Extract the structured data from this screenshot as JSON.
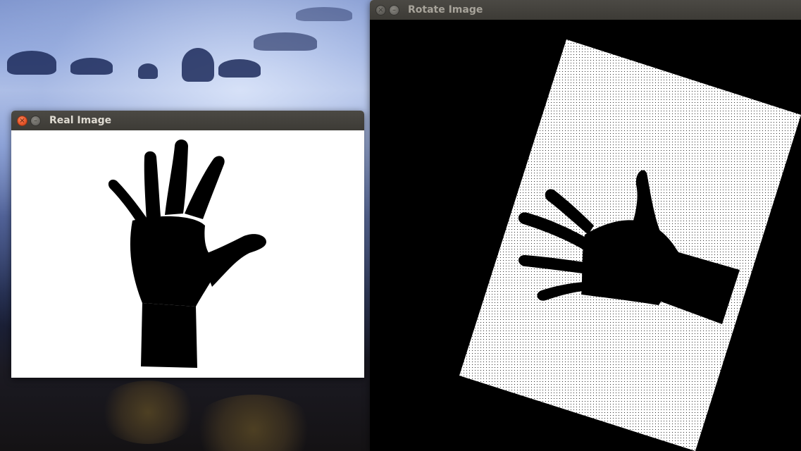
{
  "desktop": {
    "wallpaper": "misty-blue-landscape"
  },
  "windows": {
    "real": {
      "title": "Real Image",
      "active": true,
      "canvas_background": "#ffffff",
      "shape_color": "#000000",
      "content": "hand-silhouette"
    },
    "rotate": {
      "title": "Rotate Image",
      "active": false,
      "canvas_background": "#000000",
      "rotated_panel_color": "#ffffff",
      "shape_color": "#000000",
      "content": "rotated-hand-silhouette"
    }
  },
  "icons": {
    "close": "×",
    "minimize": "–"
  }
}
